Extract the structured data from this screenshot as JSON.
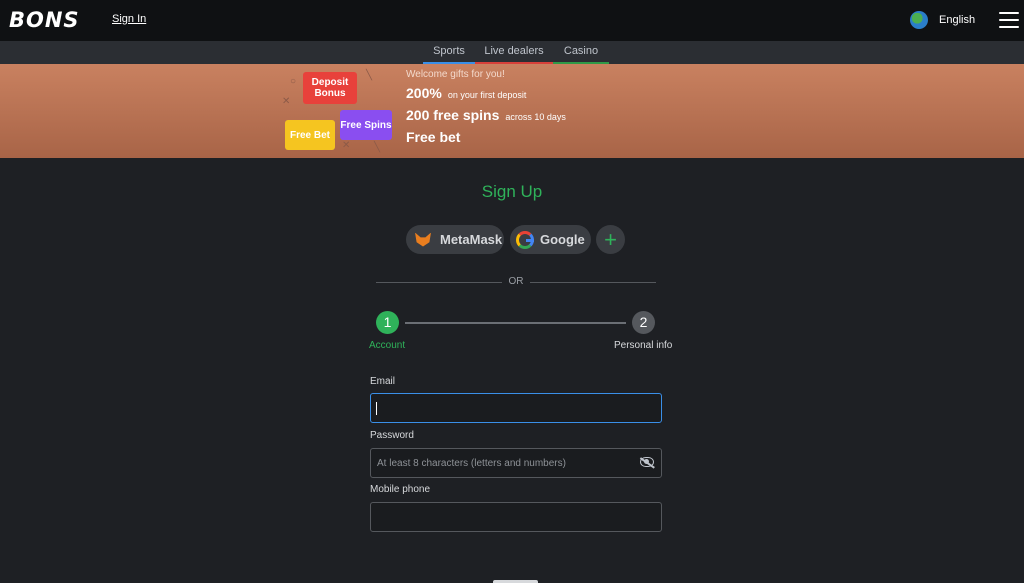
{
  "header": {
    "logo": "BONS",
    "signin_label": "Sign In",
    "language": "English",
    "language_icon": "globe-icon",
    "menu_icon": "hamburger-menu-icon"
  },
  "subnav": {
    "tabs": [
      {
        "label": "Sports",
        "color": "#3a8fe8"
      },
      {
        "label": "Live dealers",
        "color": "#d7403a"
      },
      {
        "label": "Casino",
        "color": "#2f9a47"
      }
    ]
  },
  "banner": {
    "tiles": {
      "deposit": "Deposit Bonus",
      "freebet": "Free Bet",
      "spins": "Free Spins"
    },
    "welcome": "Welcome gifts for you!",
    "line1_big": "200%",
    "line1_small": "on your first deposit",
    "line2_big": "200 free spins",
    "line2_small": "across 10 days",
    "line3_big": "Free bet"
  },
  "signup": {
    "title": "Sign Up",
    "accent_color": "#2fb25a",
    "oauth": {
      "metamask": "MetaMask",
      "google": "Google",
      "more": "+"
    },
    "or_text": "OR",
    "steps": [
      {
        "number": "1",
        "label": "Account"
      },
      {
        "number": "2",
        "label": "Personal info"
      }
    ],
    "fields": {
      "email_label": "Email",
      "email_value": "",
      "password_label": "Password",
      "password_placeholder": "At least 8 characters (letters and numbers)",
      "phone_label": "Mobile phone",
      "phone_value": ""
    }
  }
}
